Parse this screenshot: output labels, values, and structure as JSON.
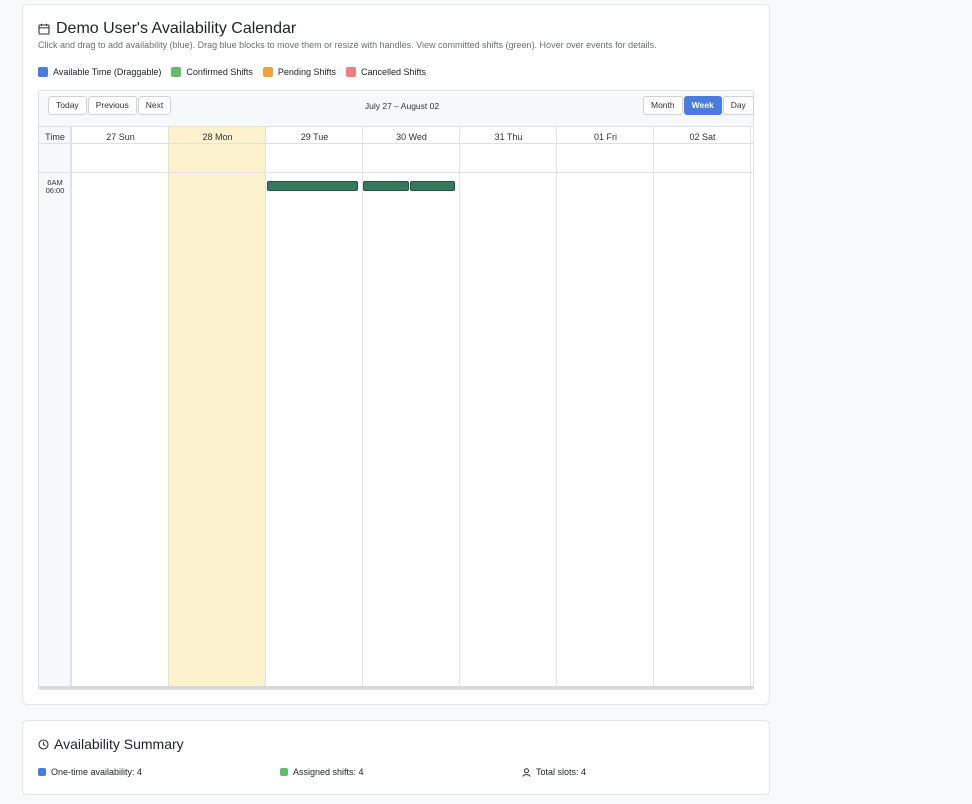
{
  "calendar": {
    "title": "Demo User's Availability Calendar",
    "subtitle": "Click and drag to add availability (blue). Drag blue blocks to move them or resize with handles. View committed shifts (green). Hover over events for details.",
    "legend": [
      {
        "label": "Available Time (Draggable)",
        "color": "#4a7ce0"
      },
      {
        "label": "Confirmed Shifts",
        "color": "#66bb6a"
      },
      {
        "label": "Pending Shifts",
        "color": "#f0a33c"
      },
      {
        "label": "Cancelled Shifts",
        "color": "#ee7f80"
      }
    ],
    "nav": {
      "today": "Today",
      "previous": "Previous",
      "next": "Next"
    },
    "range": "July 27 – August 02",
    "views": {
      "month": "Month",
      "week": "Week",
      "day": "Day",
      "active": "week"
    },
    "time_header": "Time",
    "time_label_1": "6AM",
    "time_label_2": "06:00",
    "days": [
      "27 Sun",
      "28 Mon",
      "29 Tue",
      "30 Wed",
      "31 Thu",
      "01 Fri",
      "02 Sat"
    ],
    "today_index": 1,
    "events": [
      {
        "day_index": 2,
        "type": "confirmed",
        "color": "#357a5e"
      },
      {
        "day_index": 3,
        "type": "confirmed",
        "color": "#357a5e"
      },
      {
        "day_index": 3,
        "type": "confirmed",
        "color": "#357a5e"
      }
    ]
  },
  "summary": {
    "title": "Availability Summary",
    "one_time": "One-time availability: 4",
    "assigned": "Assigned shifts: 4",
    "total": "Total slots: 4"
  },
  "colors": {
    "accent": "#4a7ce0",
    "confirmed": "#66bb6a",
    "today_bg": "#fcf2cd"
  }
}
